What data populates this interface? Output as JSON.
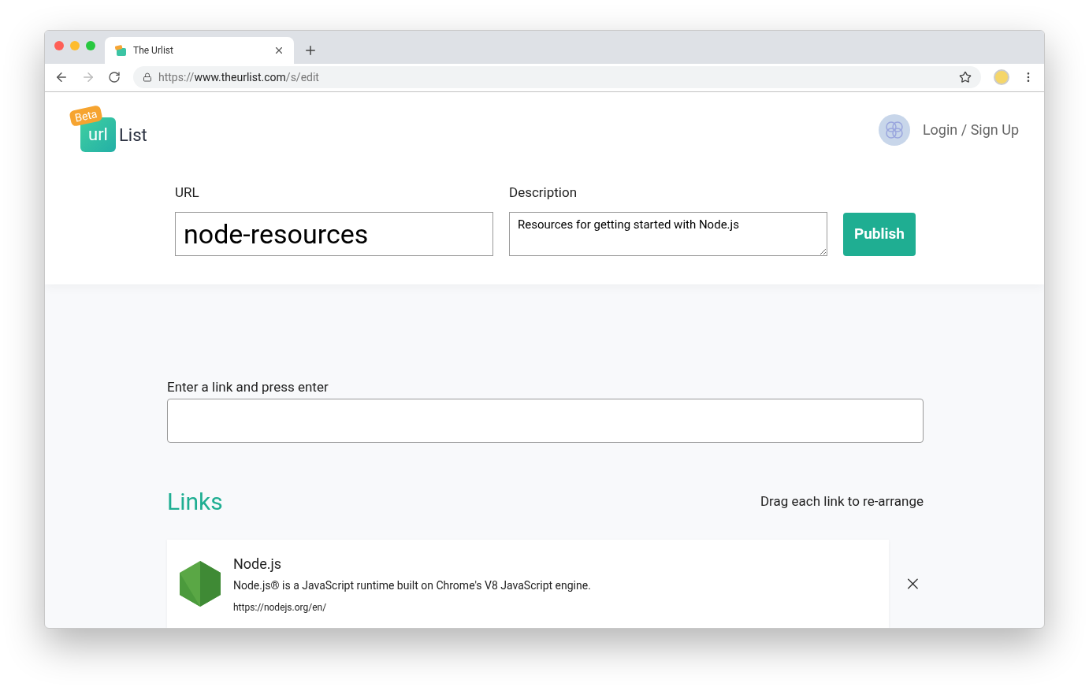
{
  "browser": {
    "tab": {
      "title": "The Urlist",
      "selected": true
    },
    "address": {
      "scheme": "https://",
      "host": "www.theurlist.com",
      "path": "/s/edit"
    }
  },
  "header": {
    "logo": {
      "badge": "Beta",
      "mark": "url",
      "word": "List"
    },
    "login": "Login / Sign Up"
  },
  "form": {
    "url": {
      "label": "URL",
      "value": "node-resources"
    },
    "description": {
      "label": "Description",
      "value": "Resources for getting started with Node.js"
    },
    "publish": "Publish"
  },
  "link_entry": {
    "label": "Enter a link and press enter"
  },
  "links": {
    "title": "Links",
    "hint": "Drag each link to re-arrange",
    "items": [
      {
        "title": "Node.js",
        "description": "Node.js® is a JavaScript runtime built on Chrome's V8 JavaScript engine.",
        "url": "https://nodejs.org/en/"
      }
    ]
  }
}
